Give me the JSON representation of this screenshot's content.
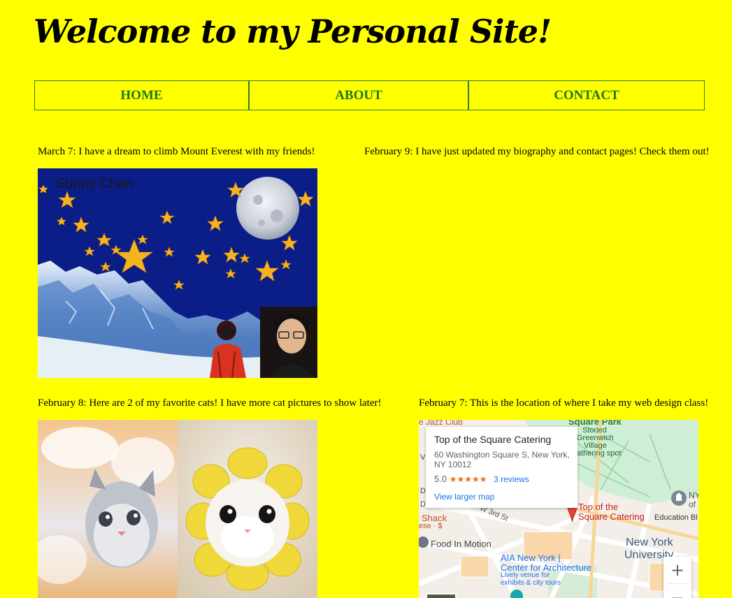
{
  "header": {
    "title": "Welcome to my Personal Site!"
  },
  "nav": {
    "items": [
      "HOME",
      "ABOUT",
      "CONTACT"
    ]
  },
  "posts": [
    {
      "text": "March 7: I have a dream to climb Mount Everest with my friends!",
      "image_caption": "Sunny Chan"
    },
    {
      "text": "February 9: I have just updated my biography and contact pages! Check them out!"
    },
    {
      "text": "February 8: Here are 2 of my favorite cats! I have more cat pictures to show later!"
    },
    {
      "text": "February 7: This is the location of where I take my web design class!"
    }
  ],
  "map": {
    "place_name": "Top of the Square Catering",
    "address": "60 Washington Square S, New York, NY 10012",
    "rating": "5.0",
    "stars": "★★★★★",
    "reviews": "3 reviews",
    "larger_map": "View larger map",
    "labels": {
      "jazz_club": "e Jazz Club",
      "square_park": "Square Park",
      "storied": "Storied",
      "greenwich": "Greenwich",
      "village": "Village",
      "gathering": "athering spot",
      "pin_line1": "Top of the",
      "pin_line2": "Square Catering",
      "education": "Education Bl",
      "ny": "NY",
      "of": "of",
      "shack": "Shack",
      "ese": "ese · $",
      "w3rd": "W 3rd St",
      "food": "Food In Motion",
      "nyu1": "New York",
      "nyu2": "University",
      "aia1": "AIA New York |",
      "aia2": "Center for Architecture",
      "aia3": "Lively venue for",
      "aia4": "exhibits & city tours",
      "d1": "D",
      "d2": "D",
      "v": "V",
      "zoom_in": "+",
      "zoom_out": "−"
    }
  }
}
